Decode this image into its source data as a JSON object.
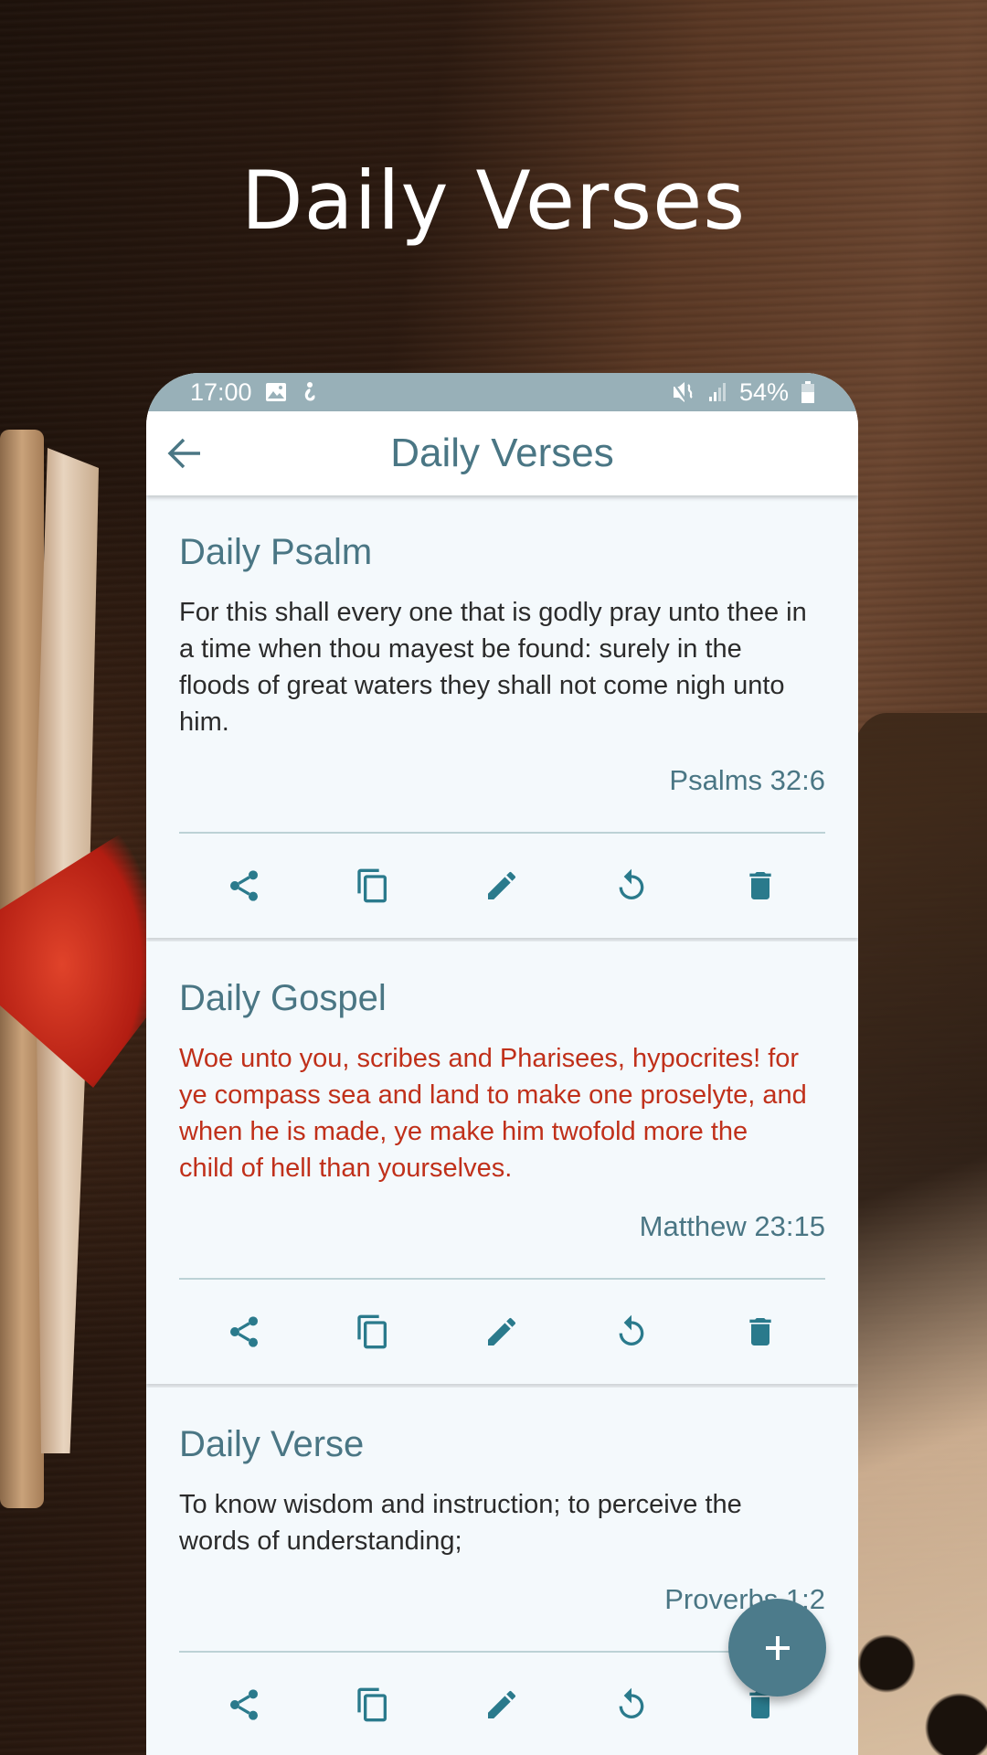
{
  "promo": {
    "title": "Daily Verses"
  },
  "status_bar": {
    "time": "17:00",
    "left_icons": [
      "image-notification-icon",
      "app-notification-icon"
    ],
    "right_icons": [
      "vibrate-mute-icon",
      "signal-icon",
      "battery-icon"
    ],
    "battery": "54%"
  },
  "app_bar": {
    "back_icon": "arrow-back-icon",
    "title": "Daily Verses"
  },
  "colors": {
    "accent": "#4a7684",
    "icon": "#2a7a8c",
    "gospel_text": "#c0301a",
    "status_bar": "#98b0b8",
    "fab": "#4c7b8b"
  },
  "cards": [
    {
      "title": "Daily Psalm",
      "text": "For this shall every one that is godly pray unto thee in a time when thou mayest be found: surely in the floods of great waters they shall not come nigh unto him.",
      "reference": "Psalms 32:6",
      "text_style": "normal"
    },
    {
      "title": "Daily Gospel",
      "text": "Woe unto you, scribes and Pharisees, hypocrites! for ye compass sea and land to make one proselyte, and when he is made, ye make him twofold more the child of hell than yourselves.",
      "reference": "Matthew 23:15",
      "text_style": "red"
    },
    {
      "title": "Daily Verse",
      "text": "To know wisdom and instruction; to perceive the words of understanding;",
      "reference": "Proverbs 1:2",
      "text_style": "normal"
    }
  ],
  "actions": [
    {
      "name": "share",
      "icon": "share-icon"
    },
    {
      "name": "copy",
      "icon": "copy-icon"
    },
    {
      "name": "edit",
      "icon": "edit-icon"
    },
    {
      "name": "refresh",
      "icon": "refresh-icon"
    },
    {
      "name": "delete",
      "icon": "delete-icon"
    }
  ],
  "fab": {
    "icon": "plus-icon",
    "label": "+"
  }
}
